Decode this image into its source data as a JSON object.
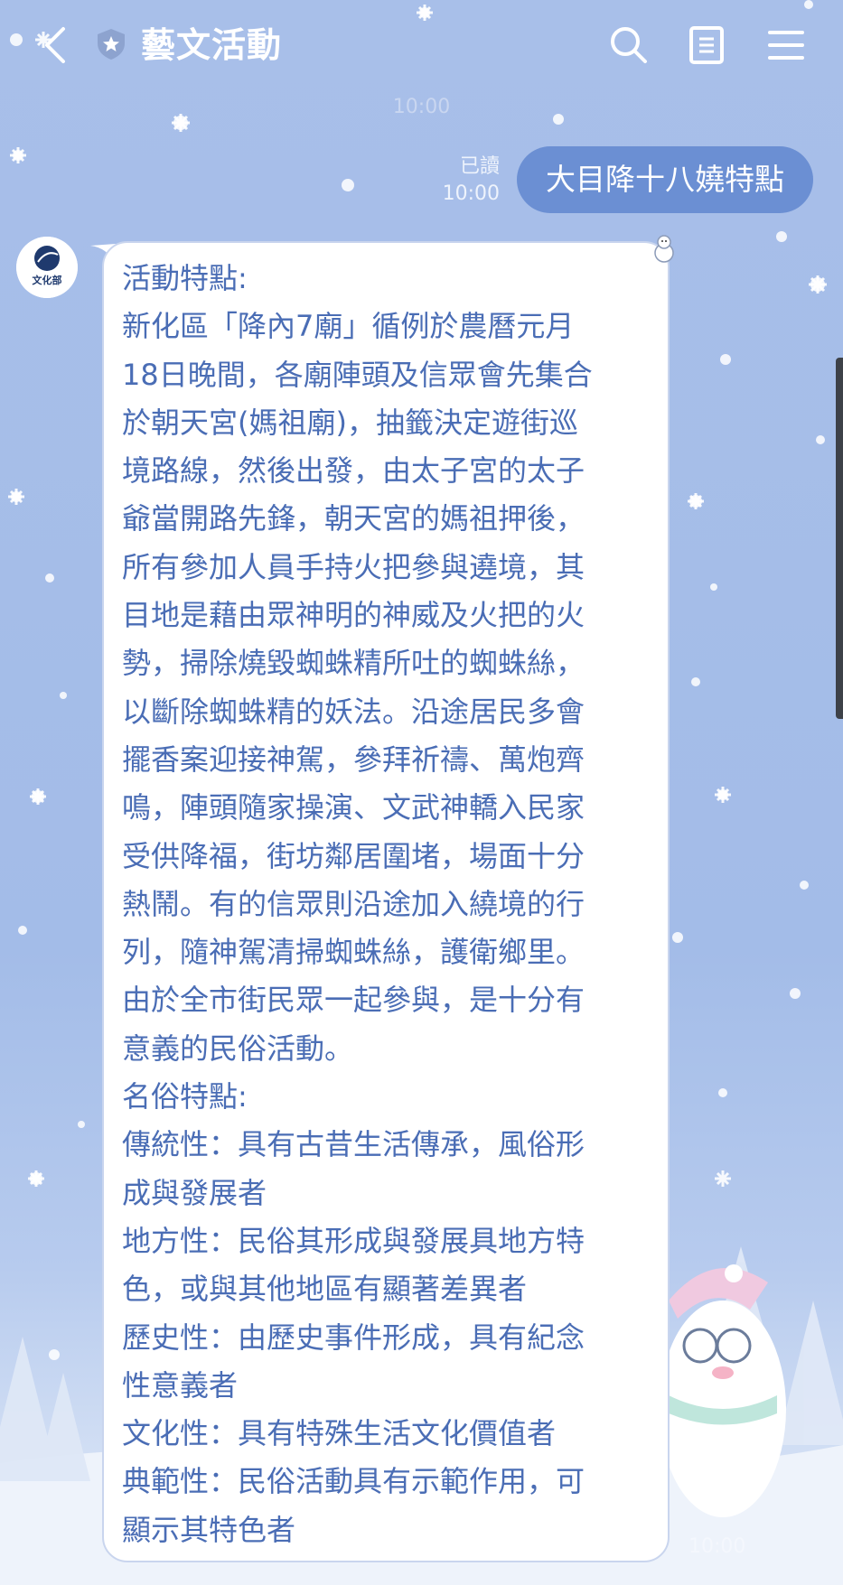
{
  "header": {
    "title": "藝文活動",
    "icons": [
      "back-arrow-icon",
      "shield-star-icon",
      "search-icon",
      "notes-icon",
      "menu-icon"
    ]
  },
  "chat": {
    "date_time": "10:00",
    "outgoing": {
      "text": "大目降十八嬈特點",
      "read_label": "已讀",
      "time": "10:00"
    },
    "incoming": {
      "sender_avatar_text": "文化部",
      "time": "10:00",
      "lines": [
        "活動特點:",
        "新化區「降內7廟」循例於農曆元月",
        "18日晚間，各廟陣頭及信眾會先集合",
        "於朝天宮(媽祖廟)，抽籤決定遊街巡",
        "境路線，然後出發，由太子宮的太子",
        "爺當開路先鋒，朝天宮的媽祖押後，",
        "所有參加人員手持火把參與遶境，其",
        "目地是藉由眾神明的神威及火把的火",
        "勢，掃除燒毀蜘蛛精所吐的蜘蛛絲，",
        "以斷除蜘蛛精的妖法。沿途居民多會",
        "擺香案迎接神駕，參拜祈禱、萬炮齊",
        "鳴，陣頭隨家操演、文武神轎入民家",
        "受供降福，街坊鄰居圍堵，場面十分",
        "熱鬧。有的信眾則沿途加入繞境的行",
        "列，隨神駕清掃蜘蛛絲，護衛鄉里。",
        "由於全市街民眾一起參與，是十分有",
        "意義的民俗活動。",
        "名俗特點:",
        "傳統性：具有古昔生活傳承，風俗形",
        "成與發展者",
        "地方性：民俗其形成與發展具地方特",
        "色，或與其他地區有顯著差異者",
        "歷史性：由歷史事件形成，具有紀念",
        "性意義者",
        "文化性：具有特殊生活文化價值者",
        "典範性：民俗活動具有示範作用，可",
        "顯示其特色者"
      ]
    }
  },
  "colors": {
    "background": "#a8bfe9",
    "outgoing_bubble": "#6b8fd3",
    "incoming_text": "#4a6db5",
    "header_text": "#ffffff"
  }
}
